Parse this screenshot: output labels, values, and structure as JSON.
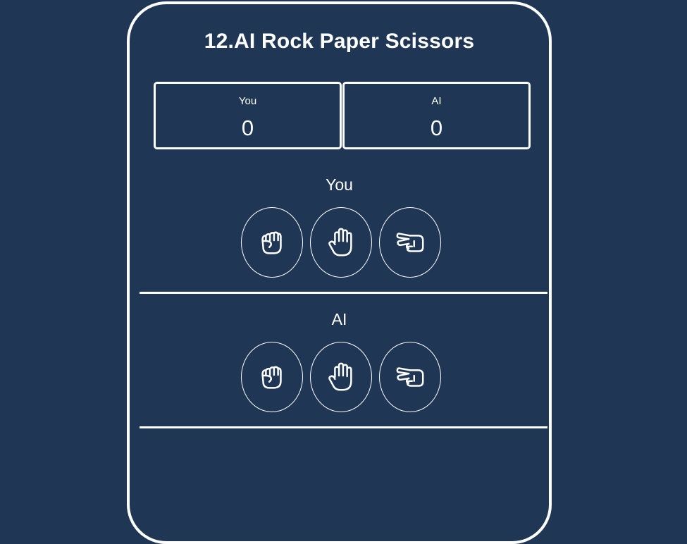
{
  "title": "12.AI Rock Paper Scissors",
  "scoreboard": {
    "player": {
      "name": "You",
      "score": "0"
    },
    "ai": {
      "name": "AI",
      "score": "0"
    }
  },
  "player_section": {
    "label": "You",
    "choices": [
      {
        "name": "rock",
        "icon": "fist-icon"
      },
      {
        "name": "paper",
        "icon": "open-hand-icon"
      },
      {
        "name": "scissors",
        "icon": "scissors-hand-icon"
      }
    ]
  },
  "ai_section": {
    "label": "AI",
    "choices": [
      {
        "name": "rock",
        "icon": "fist-icon"
      },
      {
        "name": "paper",
        "icon": "open-hand-icon"
      },
      {
        "name": "scissors",
        "icon": "scissors-hand-icon"
      }
    ]
  },
  "colors": {
    "background": "#1f3655",
    "foreground": "#ffffff"
  }
}
